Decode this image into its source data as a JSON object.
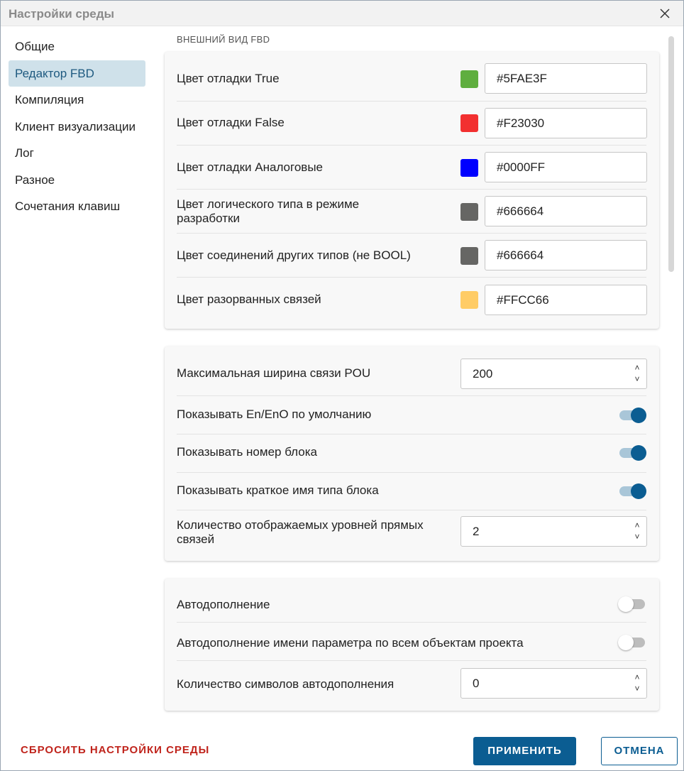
{
  "window": {
    "title": "Настройки среды"
  },
  "sidebar": {
    "items": [
      {
        "label": "Общие"
      },
      {
        "label": "Редактор FBD",
        "active": true
      },
      {
        "label": "Компиляция"
      },
      {
        "label": "Клиент визуализации"
      },
      {
        "label": "Лог"
      },
      {
        "label": "Разное"
      },
      {
        "label": "Сочетания клавиш"
      }
    ]
  },
  "appearance": {
    "section_title": "ВНЕШНИЙ ВИД FBD",
    "rows": [
      {
        "label": "Цвет отладки True",
        "color": "#5FAE3F",
        "value": "#5FAE3F"
      },
      {
        "label": "Цвет отладки False",
        "color": "#F23030",
        "value": "#F23030"
      },
      {
        "label": "Цвет отладки Аналоговые",
        "color": "#0000FF",
        "value": "#0000FF"
      },
      {
        "label": "Цвет логического типа в режиме разработки",
        "color": "#666664",
        "value": "#666664"
      },
      {
        "label": "Цвет соединений других типов (не BOOL)",
        "color": "#666664",
        "value": "#666664"
      },
      {
        "label": "Цвет разорванных связей",
        "color": "#FFCC66",
        "value": "#FFCC66"
      }
    ]
  },
  "links": {
    "max_width": {
      "label": "Максимальная ширина связи POU",
      "value": "200"
    },
    "show_en_eno": {
      "label": "Показывать En/EnO по умолчанию",
      "on": true
    },
    "show_block_number": {
      "label": "Показывать номер блока",
      "on": true
    },
    "show_short_type": {
      "label": "Показывать краткое имя типа блока",
      "on": true
    },
    "levels": {
      "label": "Количество отображаемых уровней прямых связей",
      "value": "2"
    }
  },
  "autocomplete": {
    "enabled": {
      "label": "Автодополнение",
      "on": false
    },
    "all_objects": {
      "label": "Автодополнение имени параметра по всем объектам проекта",
      "on": false
    },
    "chars": {
      "label": "Количество символов автодополнения",
      "value": "0"
    }
  },
  "footer": {
    "reset_label": "СБРОСИТЬ НАСТРОЙКИ СРЕДЫ",
    "apply_label": "ПРИМЕНИТЬ",
    "cancel_label": "ОТМЕНА"
  },
  "colors": {
    "accent": "#0B5D92",
    "danger": "#C0241C",
    "active_nav_bg": "#CFE1EA"
  },
  "icons": {
    "close": "close-icon",
    "spin_up": "chevron-up-icon",
    "spin_down": "chevron-down-icon"
  }
}
